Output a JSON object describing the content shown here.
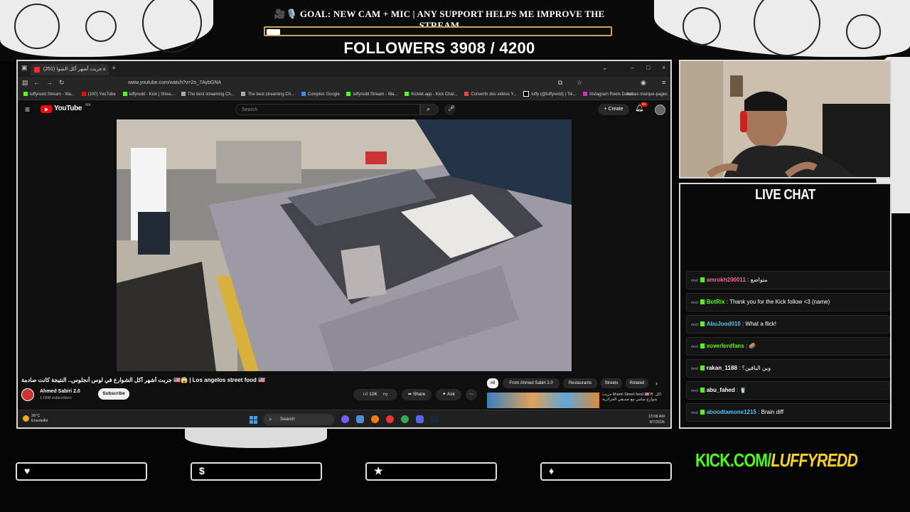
{
  "overlay": {
    "goal_text": "🎥🎙️ GOAL: NEW CAM + MIC | ANY SUPPORT HELPS ME IMPROVE THE STREAM",
    "goal_progress": 0.04,
    "followers_text": "FOLLOWERS 3908 / 4200",
    "live_chat_title": "LIVE CHAT",
    "kick_url_prefix": "KICK.COM/",
    "kick_url_name": "LUFFYREDD",
    "accent_color": "#53fc18",
    "frame_color": "#d8d8d8",
    "bottom_boxes": [
      {
        "icon": "heart-icon",
        "glyph": "♥"
      },
      {
        "icon": "dollar-icon",
        "glyph": "$"
      },
      {
        "icon": "star-icon",
        "glyph": "★"
      },
      {
        "icon": "diamond-icon",
        "glyph": "♦"
      }
    ]
  },
  "browser": {
    "tab_title": "(251) جربت أشهر أكل الشوا...",
    "url": "www.youtube.com/watch?v=2o_7AybGNA",
    "bookmarks": [
      "luffyredd Stream - Wa...",
      "(100) YouTube",
      "luffyredd - Kick | Strea...",
      "The best streaming Ch...",
      "The best streaming Ch...",
      "Comptes Google",
      "luffyredd Stream - Wa...",
      "Kicklet.app - Kick Chat...",
      "Convertir des vidéos Y...",
      "luffy (@luffyredd) | Tik...",
      "Instagram Reels Down..."
    ],
    "bookmarks_more": "Autres marque-pages"
  },
  "youtube": {
    "logo_text": "YouTube",
    "region": "MA",
    "search_placeholder": "Search",
    "create_label": "Create",
    "notif_count": "9+",
    "video_title": "جربت أشهر أكل الشوارع في لوس أنجلوس.. النتيجة كانت صادمة 🇺🇸😱 | Los angelos street food 🇺🇸",
    "channel_name": "Ahmed Sabiri 2.0",
    "subscribers": "1.05M subscribers",
    "subscribe_label": "Subscribe",
    "likes": "10K",
    "share_label": "Share",
    "ask_label": "Ask",
    "chips": [
      "All",
      "From Ahmed Sabiri 2.0",
      "Restaurants",
      "Streets",
      "Related"
    ],
    "rec_title": "جربت Miami Street food 🇺🇸🌴 أكل شوارع ميامي مع صديقي الجزائرية"
  },
  "taskbar": {
    "temp": "26°C",
    "weather": "Ensoleillé",
    "search_label": "Search",
    "time": "13:08 AM",
    "date": "8/7/2026"
  },
  "chat": [
    {
      "user": "amrokh200011",
      "text": ": متواضع",
      "color": "#ff5fa2"
    },
    {
      "user": "BotRix",
      "text": ": Thank you for the Kick follow <3 (name)",
      "color": "#53fc18"
    },
    {
      "user": "AbuJood010",
      "text": ": What a flick!",
      "color": "#4fc3f7"
    },
    {
      "user": "xoverlordfans",
      "text": ": 🥔",
      "color": "#53fc18"
    },
    {
      "user": "rakan_1188",
      "text": ": وين الباقين؟",
      "color": "#ffffff"
    },
    {
      "user": "abu_fahed",
      "text": ": 🥤",
      "color": "#ffffff"
    },
    {
      "user": "aboodtamone1215",
      "text": ": Brain diff",
      "color": "#4fc3f7"
    }
  ]
}
